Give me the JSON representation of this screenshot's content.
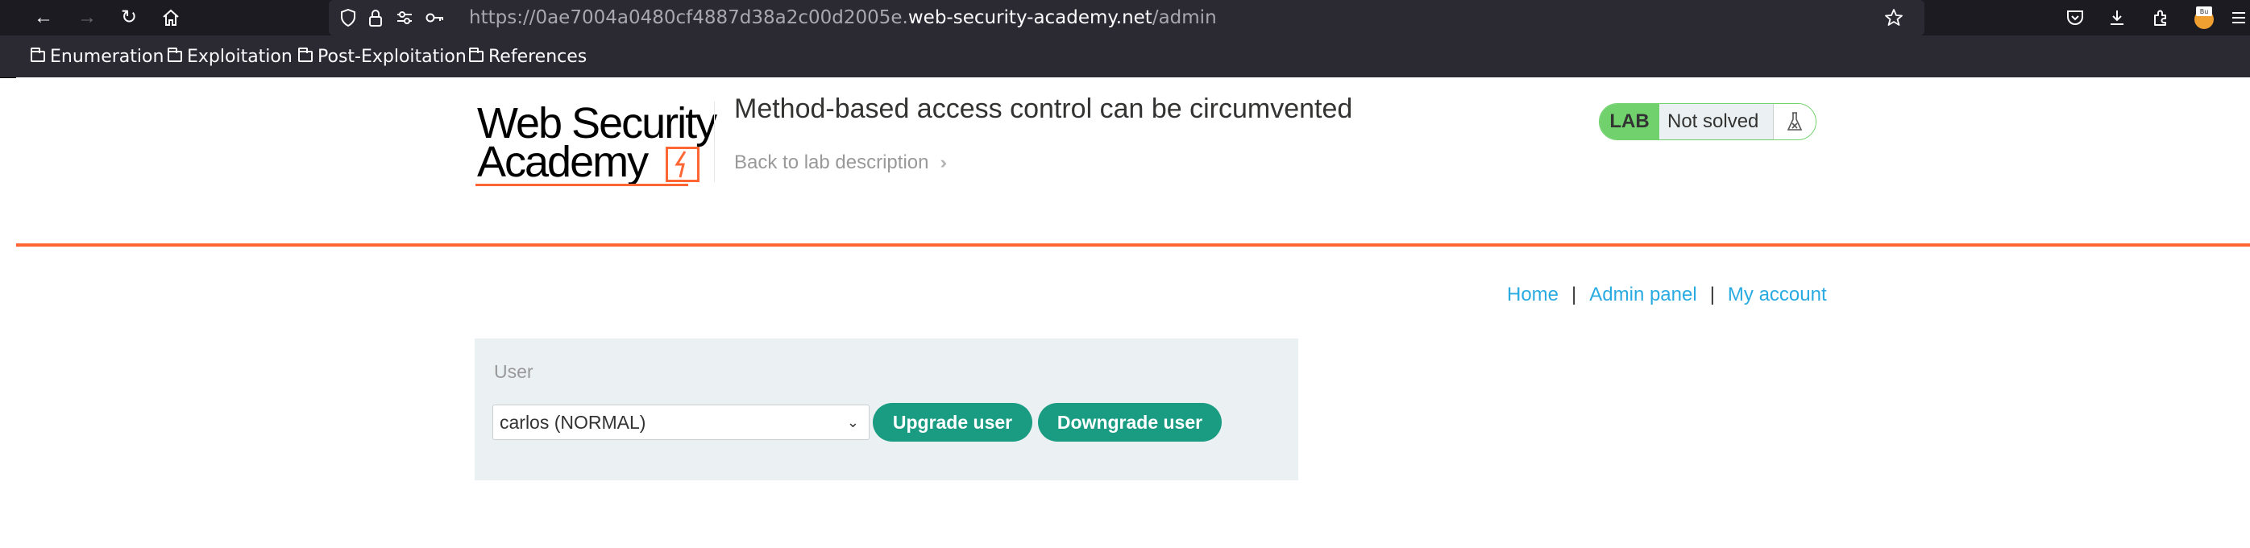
{
  "browser": {
    "url_prefix": "https://0ae7004a0480cf4887d38a2c00d2005e.",
    "url_host": "web-security-academy.net",
    "url_path": "/admin",
    "bookmarks": [
      "Enumeration",
      "Exploitation",
      "Post-Exploitation",
      "References"
    ],
    "icons": [
      "back-arrow-icon",
      "forward-arrow-icon",
      "reload-icon",
      "home-icon",
      "shield-icon",
      "lock-icon",
      "permissions-icon",
      "key-icon",
      "star-icon",
      "pocket-icon",
      "download-icon",
      "extensions-icon",
      "burp-extension-icon",
      "menu-icon"
    ]
  },
  "header": {
    "logo_line1": "Web Security",
    "logo_line2": "Academy",
    "lab_title": "Method-based access control can be circumvented",
    "back_link": "Back to lab description",
    "lab_tag": "LAB",
    "lab_status": "Not solved",
    "colors": {
      "accent": "#ff6633",
      "lab_green": "#70d16d",
      "link": "#29abe2",
      "button": "#1a9c82"
    }
  },
  "nav": {
    "home": "Home",
    "sep1": "|",
    "admin": "Admin panel",
    "sep2": "|",
    "account": "My account"
  },
  "admin_panel": {
    "label": "User",
    "selected_user": "carlos (NORMAL)",
    "upgrade_button": "Upgrade user",
    "downgrade_button": "Downgrade user"
  }
}
